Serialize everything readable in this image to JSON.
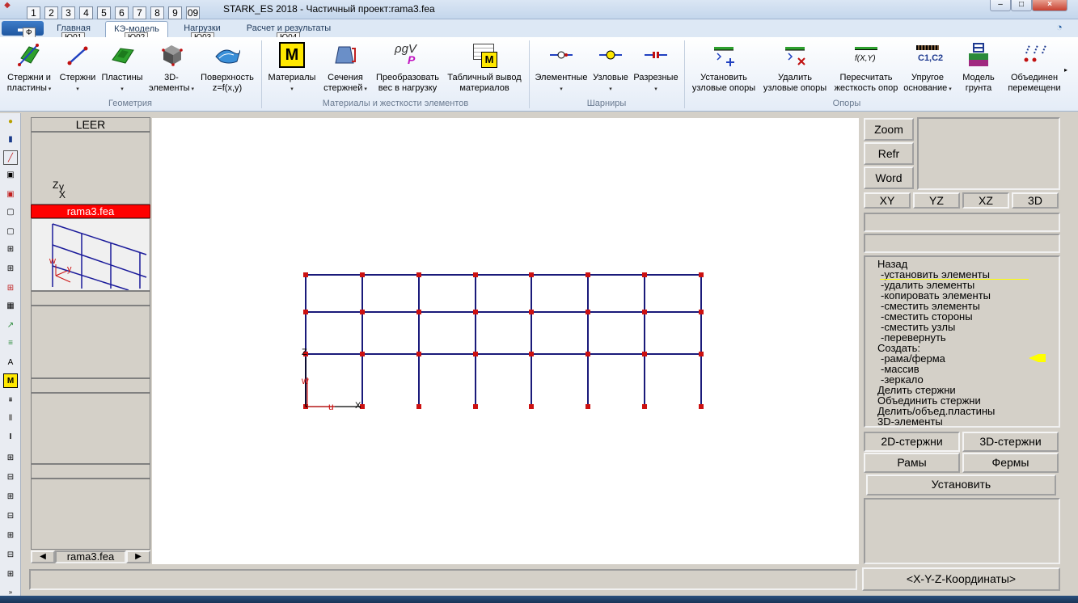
{
  "title": {
    "app_title": "STARK_ES 2018 - Частичный проект:rama3.fea",
    "qat_numbers": [
      "1",
      "2",
      "3",
      "4",
      "5",
      "6",
      "7",
      "8",
      "9",
      "09"
    ],
    "window_buttons": [
      "–",
      "□",
      "×"
    ]
  },
  "tabs": {
    "app_menu": "",
    "items": [
      "Главная",
      "КЭ-модель",
      "Нагрузки",
      "Расчет и результаты"
    ],
    "active_index": 1,
    "keytips": [
      "Ф",
      "Ю01",
      "Ю02",
      "Ю03",
      "Ю04"
    ]
  },
  "ribbon": {
    "geometry_group": "Геометрия",
    "materials_group": "Материалы и жесткости элементов",
    "hinges_group": "Шарниры",
    "supports_group": "Опоры",
    "buttons": [
      {
        "line1": "Стержни и",
        "line2": "пластины",
        "icon": "rods-plates-icon"
      },
      {
        "line1": "Стержни",
        "line2": "",
        "icon": "rods-icon"
      },
      {
        "line1": "Пластины",
        "line2": "",
        "icon": "plates-icon"
      },
      {
        "line1": "3D-",
        "line2": "элементы",
        "icon": "solid-3d-icon"
      },
      {
        "line1": "Поверхность",
        "line2": "z=f(x,y)",
        "icon": "surface-icon"
      },
      {
        "line1": "Материалы",
        "line2": "",
        "icon": "materials-icon"
      },
      {
        "line1": "Сечения",
        "line2": "стержней",
        "icon": "sections-icon"
      },
      {
        "line1": "Преобразовать",
        "line2": "вес в нагрузку",
        "icon": "weight-to-load-icon"
      },
      {
        "line1": "Табличный вывод",
        "line2": "материалов",
        "icon": "table-materials-icon"
      },
      {
        "line1": "Элементные",
        "line2": "",
        "icon": "element-hinge-icon"
      },
      {
        "line1": "Узловые",
        "line2": "",
        "icon": "node-hinge-icon"
      },
      {
        "line1": "Разрезные",
        "line2": "",
        "icon": "split-hinge-icon"
      },
      {
        "line1": "Установить",
        "line2": "узловые опоры",
        "icon": "set-support-icon"
      },
      {
        "line1": "Удалить",
        "line2": "узловые опоры",
        "icon": "delete-support-icon"
      },
      {
        "line1": "Пересчитать",
        "line2": "жесткость опор",
        "icon": "recalc-stiffness-icon"
      },
      {
        "line1": "Упругое",
        "line2": "основание",
        "icon": "elastic-base-icon"
      },
      {
        "line1": "Модель",
        "line2": "грунта",
        "icon": "soil-model-icon"
      },
      {
        "line1": "Объединен",
        "line2": "перемещени",
        "icon": "merge-displacement-icon"
      }
    ],
    "icon_labels": {
      "pgv": "ρgV",
      "p": "P",
      "fxy": "f(X,Y)",
      "c1c2": "C1,C2",
      "m": "M"
    }
  },
  "left_panel": {
    "header": "LEER",
    "axis_z": "Z",
    "axis_y": "y",
    "axis_x": "X",
    "file_label": "rama3.fea",
    "thumb_w": "w",
    "thumb_y": "y",
    "nav_file": "rama3.fea",
    "nav_prev": "◀",
    "nav_next": "▶"
  },
  "canvas": {
    "label_z": "Z",
    "label_w": "w",
    "label_u": "u",
    "label_x": "X"
  },
  "right_panel": {
    "zoom": "Zoom",
    "refr": "Refr",
    "word": "Word",
    "views": [
      "XY",
      "YZ",
      "XZ",
      "3D"
    ],
    "active_view": "XZ",
    "menu": [
      "Назад",
      "-установить элементы",
      "-удалить элементы",
      "-копировать элементы",
      "-сместить элементы",
      "-сместить стороны",
      "-сместить узлы",
      "-перевернуть",
      "Создать:",
      "-рама/ферма",
      "-массив",
      "-зеркало",
      "Делить стержни",
      "Объединить стержни",
      "Делить/объед.пластины",
      "3D-элементы"
    ],
    "rods_2d": "2D-стержни",
    "rods_3d": "3D-стержни",
    "frames": "Рамы",
    "trusses": "Фермы",
    "apply": "Установить",
    "coords": "<X-Y-Z-Координаты>"
  },
  "colors": {
    "frame_line": "#1a1a7a",
    "node": "#cc1111",
    "file_highlight": "#ff0000",
    "pointer": "#ffff00"
  }
}
